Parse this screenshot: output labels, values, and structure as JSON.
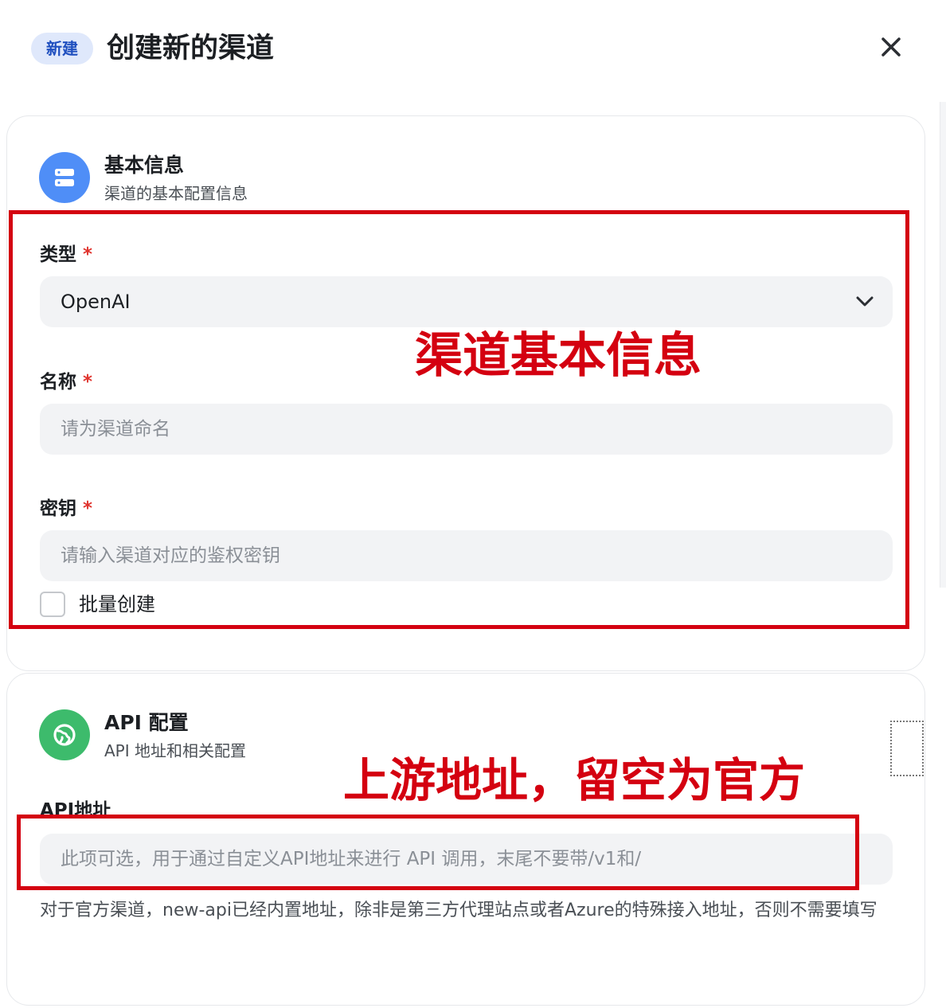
{
  "header": {
    "badge": "新建",
    "title": "创建新的渠道"
  },
  "basic_section": {
    "title": "基本信息",
    "subtitle": "渠道的基本配置信息",
    "icon": "server-icon",
    "icon_color": "#4f8ef7",
    "type_field": {
      "label": "类型",
      "required_mark": "*",
      "value": "OpenAI"
    },
    "name_field": {
      "label": "名称",
      "required_mark": "*",
      "placeholder": "请为渠道命名"
    },
    "key_field": {
      "label": "密钥",
      "required_mark": "*",
      "placeholder": "请输入渠道对应的鉴权密钥"
    },
    "batch_checkbox": {
      "label": "批量创建",
      "checked": false
    }
  },
  "api_section": {
    "title": "API 配置",
    "subtitle": "API 地址和相关配置",
    "icon": "globe-icon",
    "icon_color": "#3dbb6c",
    "api_field": {
      "label": "API地址",
      "placeholder": "此项可选，用于通过自定义API地址来进行 API 调用，末尾不要带/v1和/",
      "help": "对于官方渠道，new-api已经内置地址，除非是第三方代理站点或者Azure的特殊接入地址，否则不需要填写"
    }
  },
  "annotations": {
    "basic_info": "渠道基本信息",
    "upstream": "上游地址，留空为官方"
  },
  "colors": {
    "annotation_red": "#d40010",
    "required_red": "#e0342e"
  }
}
